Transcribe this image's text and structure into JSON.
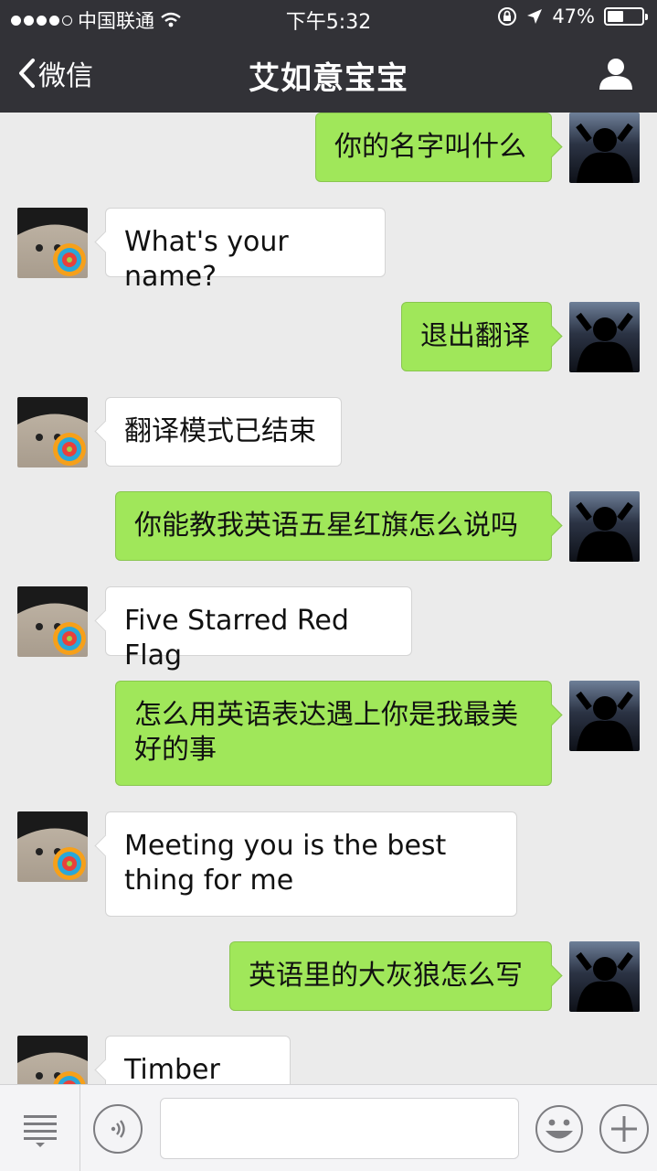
{
  "status_bar": {
    "carrier": "中国联通",
    "time": "下午5:32",
    "battery_percent": "47%",
    "battery_level": 0.47
  },
  "nav": {
    "back_label": "微信",
    "title": "艾如意宝宝"
  },
  "messages": [
    {
      "side": "right",
      "text": "你的名字叫什么"
    },
    {
      "side": "left",
      "text": "What's your name?"
    },
    {
      "side": "right",
      "text": "退出翻译"
    },
    {
      "side": "left",
      "text": "翻译模式已结束"
    },
    {
      "side": "right",
      "text": "你能教我英语五星红旗怎么说吗"
    },
    {
      "side": "left",
      "text": "Five Starred Red Flag"
    },
    {
      "side": "right",
      "text": "怎么用英语表达遇上你是我最美好的事"
    },
    {
      "side": "left",
      "text": "Meeting you is the best thing for me"
    },
    {
      "side": "right",
      "text": "英语里的大灰狼怎么写"
    },
    {
      "side": "left",
      "text": "Timber wolf"
    }
  ],
  "input_bar": {
    "icons": [
      "menu-icon",
      "voice-icon",
      "emoji-icon",
      "plus-icon"
    ]
  },
  "colors": {
    "header_bg": "#323237",
    "chat_bg": "#ebebeb",
    "my_bubble": "#a0e75a",
    "their_bubble": "#ffffff"
  }
}
